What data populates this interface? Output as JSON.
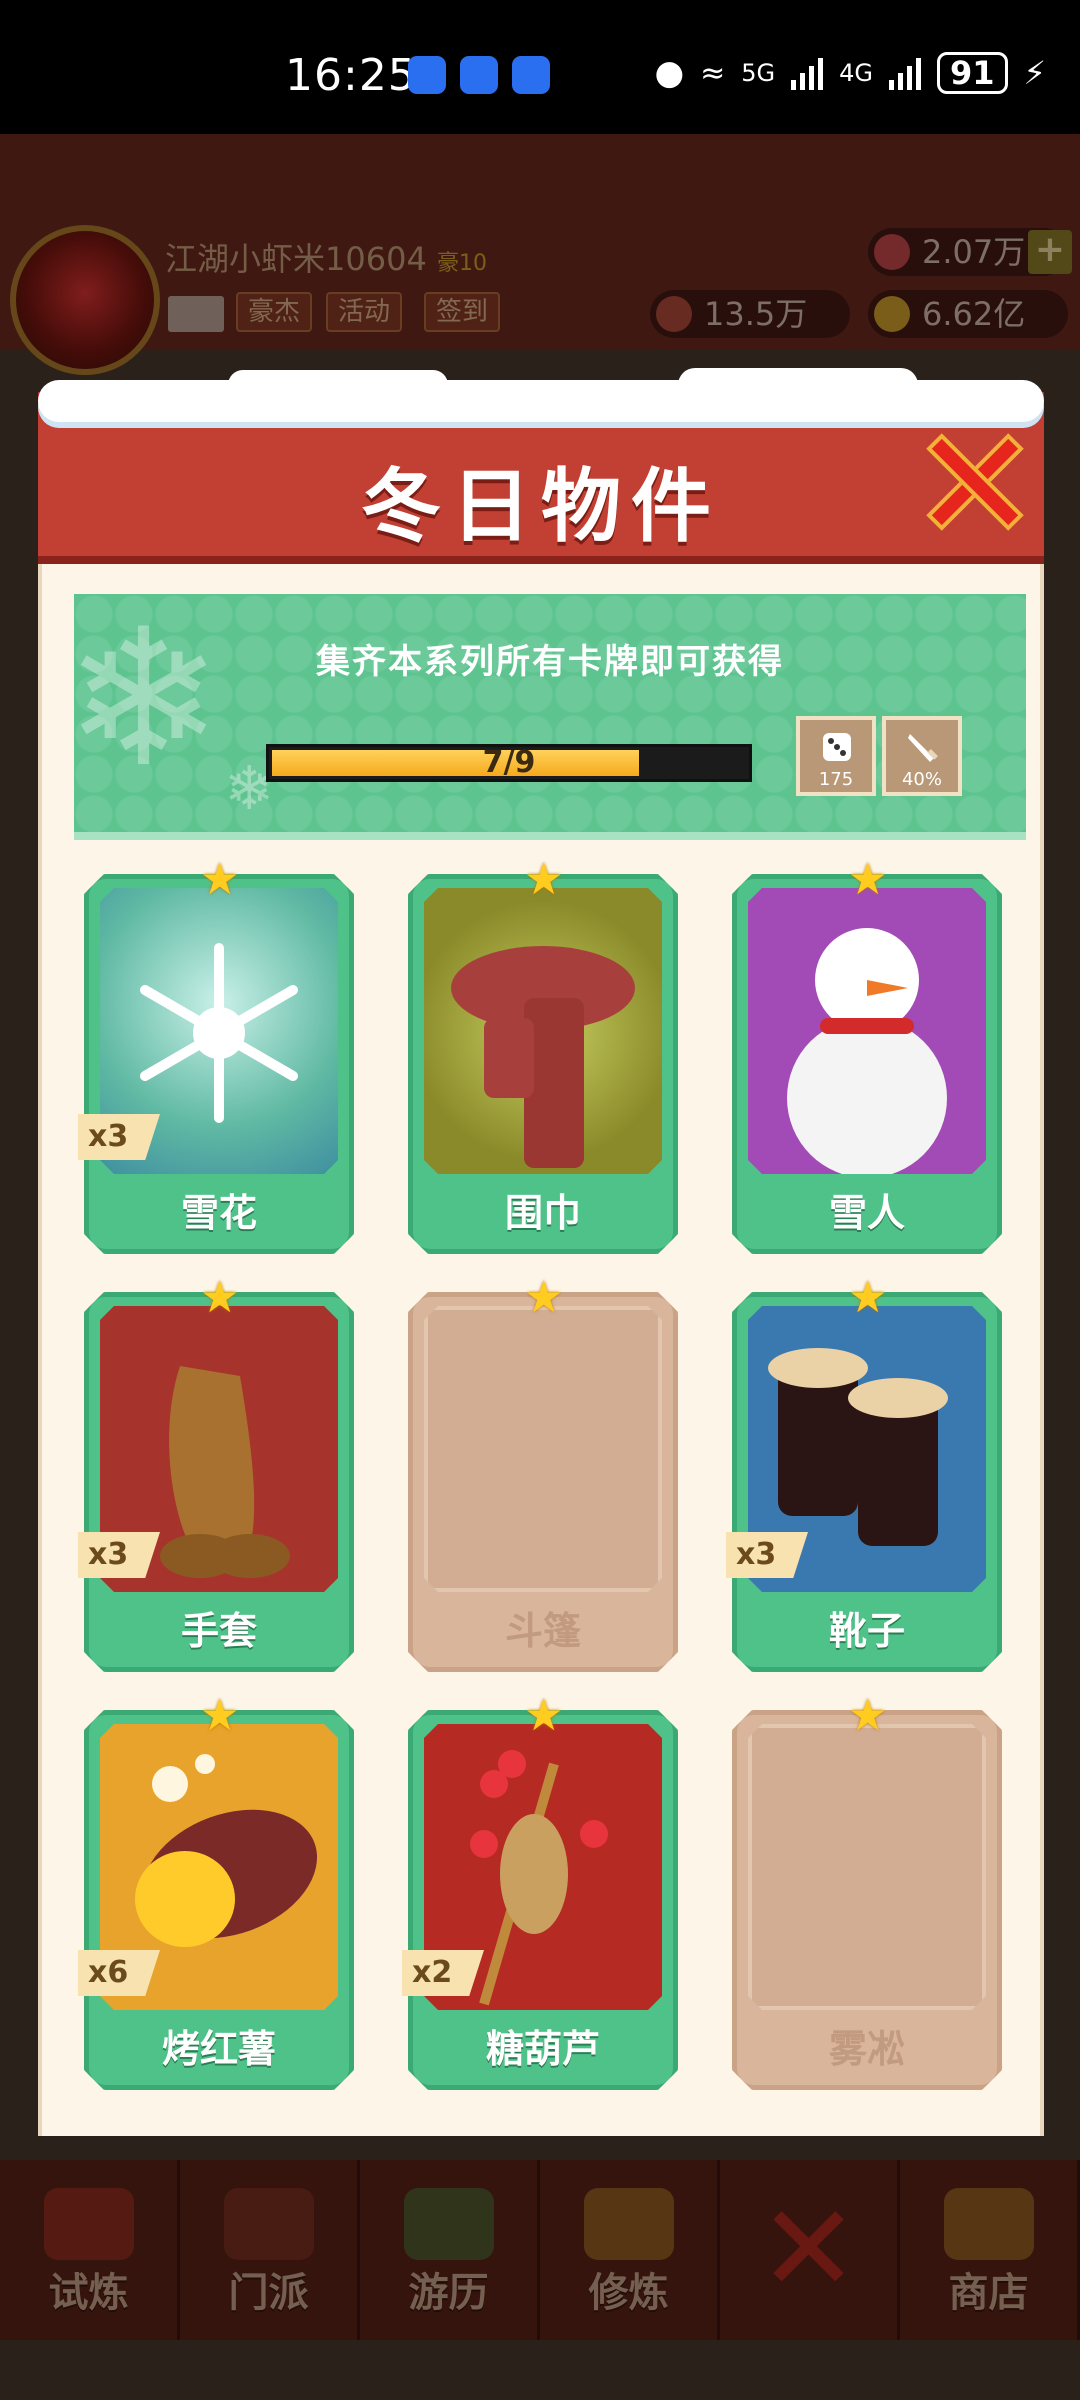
{
  "status_bar": {
    "time": "16:25",
    "network1": "5G",
    "network2": "4G",
    "battery": "91"
  },
  "hud": {
    "player_name": "江湖小虾米10604",
    "vip_label": "豪10",
    "buttons": [
      "豪杰",
      "活动",
      "签到"
    ],
    "gems": "2.07万",
    "power": "13.5万",
    "coins": "6.62亿"
  },
  "modal": {
    "title": "冬日物件",
    "banner_text": "集齐本系列所有卡牌即可获得",
    "progress": {
      "label": "7/9",
      "fraction": 0.778
    },
    "rewards": [
      {
        "icon": "dice-icon",
        "value": "175"
      },
      {
        "icon": "sword-icon",
        "value": "40%"
      }
    ],
    "cards": [
      {
        "name": "雪花",
        "count": "x3",
        "unlocked": true
      },
      {
        "name": "围巾",
        "count": "",
        "unlocked": true
      },
      {
        "name": "雪人",
        "count": "",
        "unlocked": true
      },
      {
        "name": "手套",
        "count": "x3",
        "unlocked": true
      },
      {
        "name": "斗篷",
        "count": "",
        "unlocked": false
      },
      {
        "name": "靴子",
        "count": "x3",
        "unlocked": true
      },
      {
        "name": "烤红薯",
        "count": "x6",
        "unlocked": true
      },
      {
        "name": "糖葫芦",
        "count": "x2",
        "unlocked": true
      },
      {
        "name": "雾凇",
        "count": "",
        "unlocked": false
      }
    ]
  },
  "bottom_nav": [
    {
      "label": "试炼"
    },
    {
      "label": "门派"
    },
    {
      "label": "游历"
    },
    {
      "label": "修炼"
    },
    {
      "label": ""
    },
    {
      "label": "商店"
    }
  ],
  "colors": {
    "header_red": "#c23f33",
    "card_green": "#4fc289",
    "banner_green": "#5dc48f",
    "star_gold": "#ffcc1f"
  }
}
